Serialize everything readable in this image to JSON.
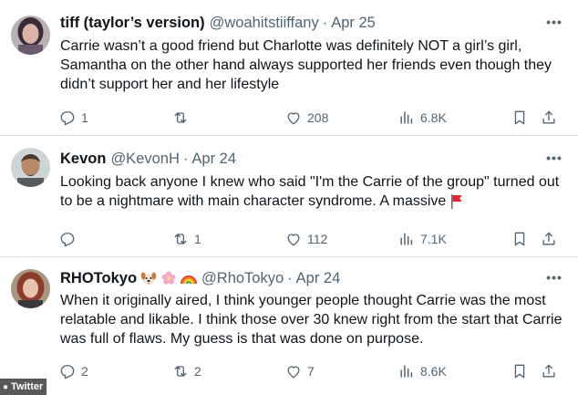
{
  "tweets": [
    {
      "name": "tiff (taylor’s version)",
      "handle": "@woahitstiiffany",
      "separator": "·",
      "date": "Apr 25",
      "text": "Carrie wasn’t a good friend but Charlotte was definitely NOT a girl’s girl, Samantha on the other hand always supported her friends even though they didn’t support her and her lifestyle",
      "replies": "1",
      "retweets": "",
      "likes": "208",
      "views": "6.8K",
      "avatar_color": "#6b5a6e"
    },
    {
      "name": "Kevon",
      "handle": "@KevonH",
      "separator": "·",
      "date": "Apr 24",
      "text": "Looking back anyone I knew who said \"I'm the Carrie of the group\" turned out to be a nightmare with main character syndrome. A massive",
      "replies": "",
      "retweets": "1",
      "likes": "112",
      "views": "7.1K",
      "avatar_color": "#8a8f93"
    },
    {
      "name": "RHOTokyo",
      "handle": "@RhoTokyo",
      "separator": "·",
      "date": "Apr 24",
      "text": "When it originally aired, I think younger people thought Carrie was the most relatable and likable. I think those over 30 knew right from the start that Carrie was full of flaws. My guess is that was done on purpose.",
      "replies": "2",
      "retweets": "2",
      "likes": "7",
      "views": "8.6K",
      "avatar_color": "#8a3d2a"
    }
  ],
  "icons": {
    "reply": "reply-icon",
    "retweet": "retweet-icon",
    "like": "heart-icon",
    "views": "analytics-icon",
    "bookmark": "bookmark-icon",
    "share": "share-icon",
    "more": "more-icon"
  },
  "watermark": {
    "label": "Twitter"
  },
  "colors": {
    "text": "#0f1419",
    "secondary": "#536471",
    "divider": "#d5dadd"
  }
}
